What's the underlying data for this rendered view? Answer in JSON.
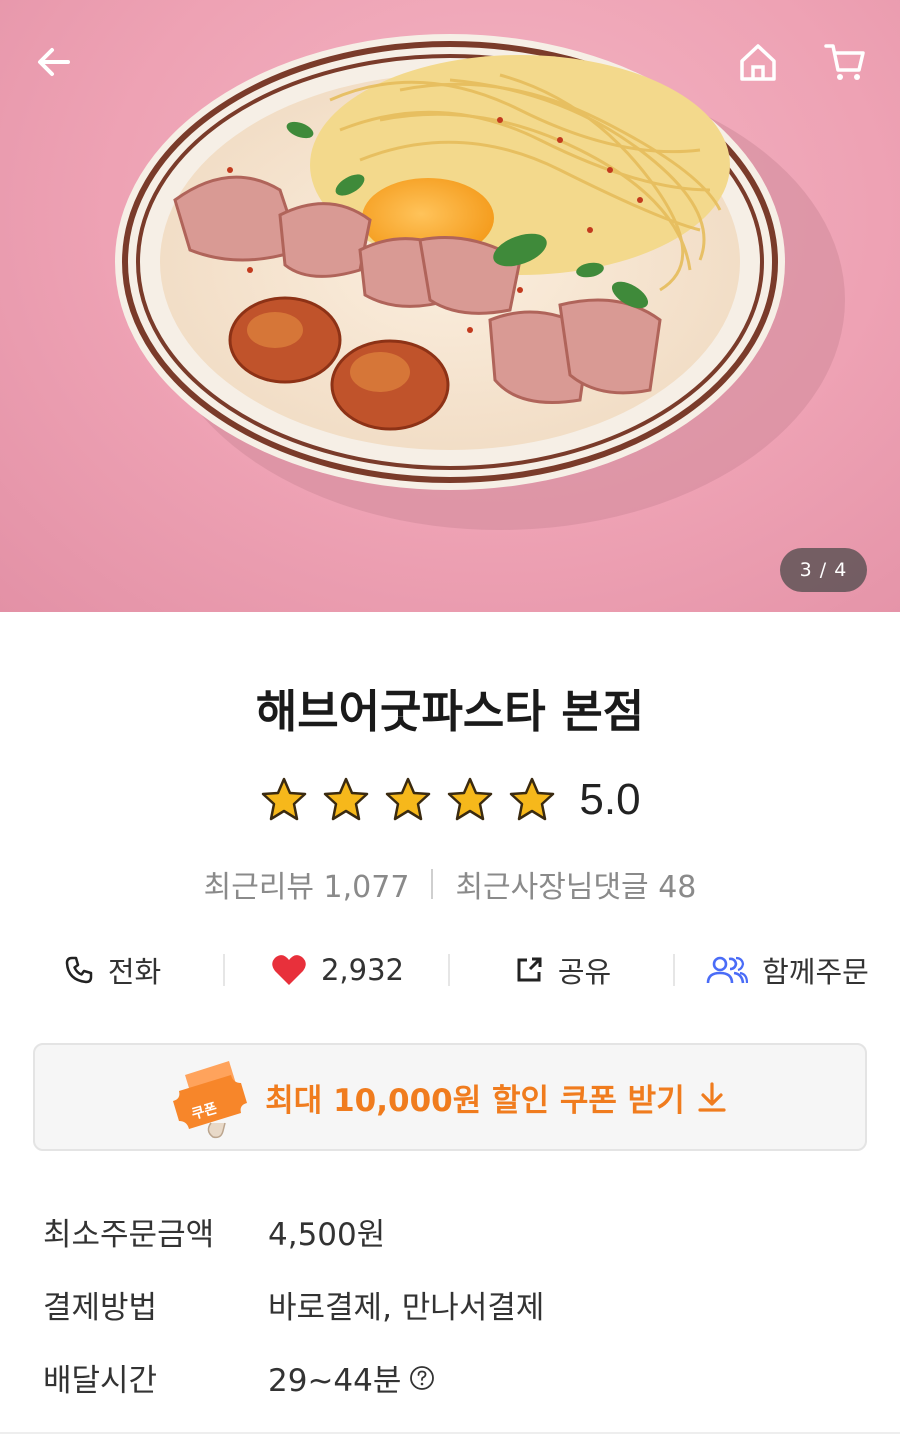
{
  "hero": {
    "pager": "3 / 4",
    "photo": "pasta-dish-photo"
  },
  "header": {
    "back_icon": "back-arrow-icon",
    "home_icon": "home-icon",
    "cart_icon": "cart-icon"
  },
  "store": {
    "name": "해브어굿파스타 본점",
    "rating": 5.0,
    "rating_text": "5.0",
    "stars_filled": 5,
    "stars_total": 5
  },
  "reviews": {
    "recent_reviews": "최근리뷰 1,077",
    "owner_replies": "최근사장님댓글 48"
  },
  "actions": [
    {
      "label": "전화",
      "icon": "phone-icon"
    },
    {
      "label": "2,932",
      "icon": "heart-icon"
    },
    {
      "label": "공유",
      "icon": "share-icon"
    },
    {
      "label": "함께주문",
      "icon": "group-order-icon"
    }
  ],
  "coupon": {
    "text": "최대 10,000원 할인 쿠폰 받기",
    "badge": "쿠폰",
    "accent": "#f07c1e"
  },
  "info": [
    {
      "label": "최소주문금액",
      "value": "4,500원"
    },
    {
      "label": "결제방법",
      "value": "바로결제, 만나서결제"
    },
    {
      "label": "배달시간",
      "value": "29~44분"
    }
  ],
  "colors": {
    "heart": "#e8303b",
    "group_icon": "#4a6cf7",
    "star": "#f6b81b"
  }
}
